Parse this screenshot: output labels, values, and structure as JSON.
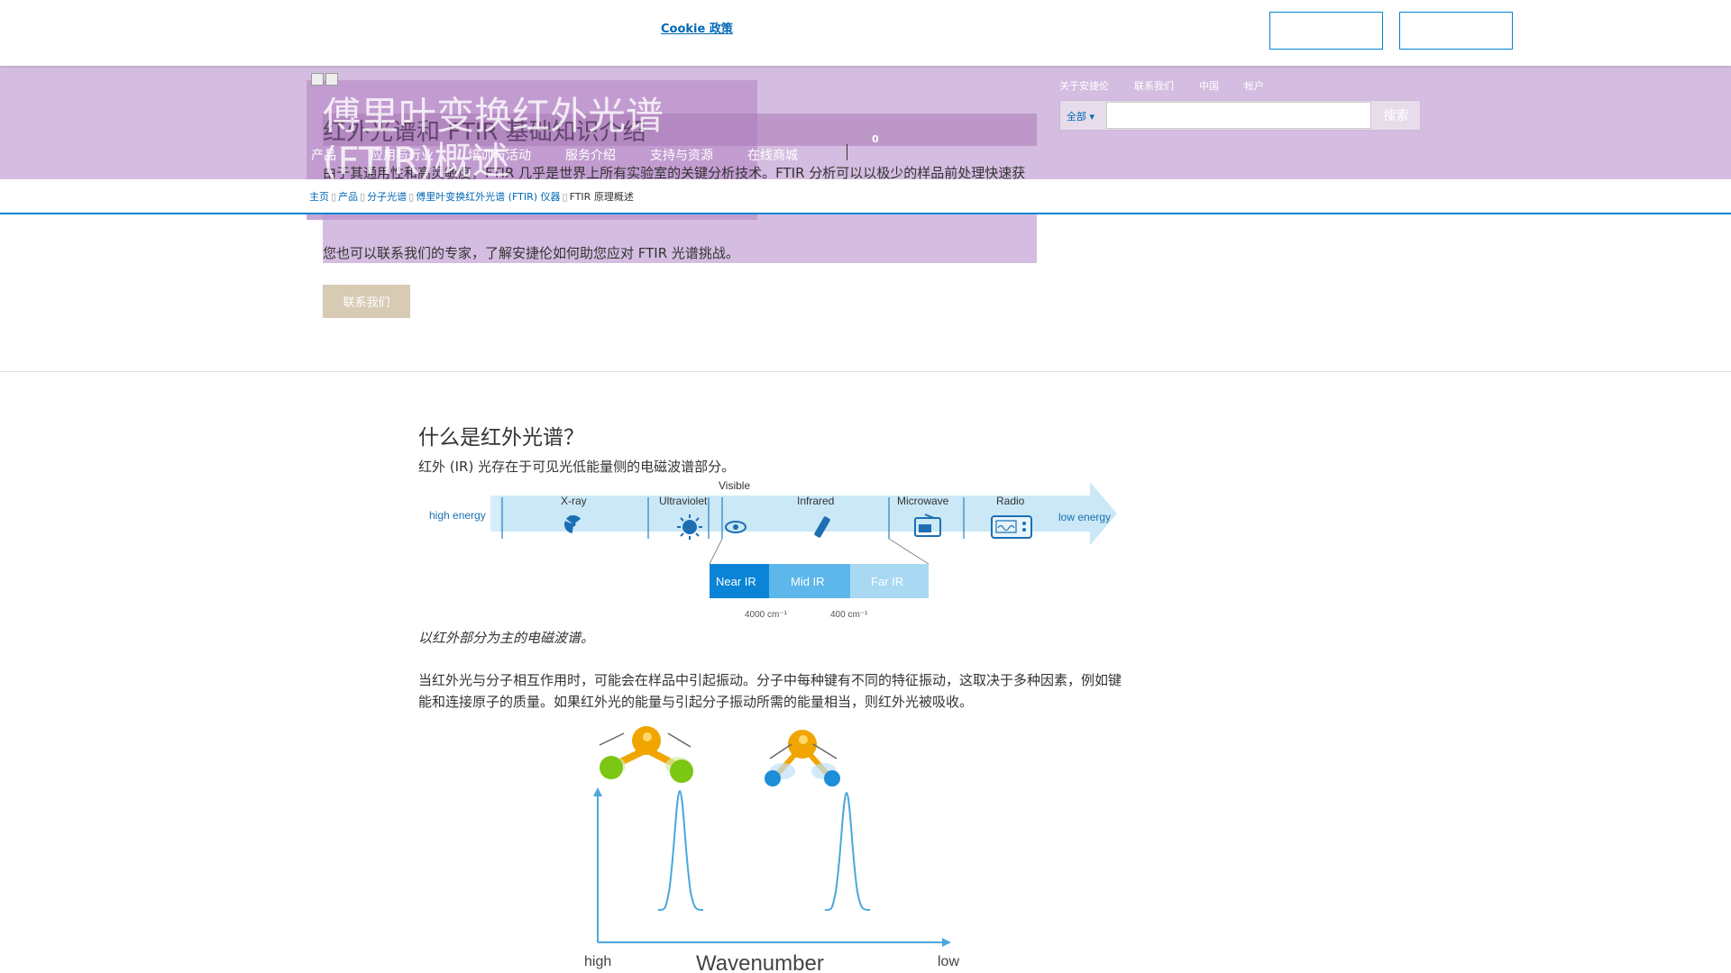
{
  "cookie": {
    "link_text": "Cookie 政策"
  },
  "header": {
    "big_title": "傅里叶变换红外光谱(FTIR)概述",
    "sub_title": "红外光谱和 FTIR 基础知识介绍",
    "nav": [
      "产品",
      "应用与行业",
      "培训与活动",
      "服务介绍",
      "支持与资源",
      "在线商城"
    ],
    "cart_count": "0",
    "util_links": [
      "关于安捷伦",
      "联系我们",
      "中国",
      "帐户"
    ],
    "search": {
      "scope_label": "全部",
      "button_label": "搜索",
      "placeholder": ""
    }
  },
  "breadcrumb": {
    "items": [
      "主页",
      "产品",
      "分子光谱",
      "傅里叶变换红外光谱 (FTIR) 仪器"
    ],
    "current": "FTIR 原理概述"
  },
  "hero": {
    "para1": "由于其通用性和高灵敏度，FTIR 几乎是世界上所有实验室的关键分析技术。FTIR 分析可以以极少的样品前处理快速获得结果。本页将介绍红外光谱基本原理。",
    "para2": "您也可以联系我们的专家，了解安捷伦如何助您应对 FTIR 光谱挑战。",
    "contact_button": "联系我们"
  },
  "article": {
    "heading": "什么是红外光谱？",
    "p1": "红外 (IR) 光存在于可见光低能量侧的电磁波谱部分。",
    "caption": "以红外部分为主的电磁波谱。",
    "p2": "当红外光与分子相互作用时，可能会在样品中引起振动。分子中每种键有不同的特征振动，这取决于多种因素，例如键能和连接原子的质量。如果红外光的能量与引起分子振动所需的能量相当，则红外光被吸收。"
  },
  "spectrum_figure": {
    "left_label": "high energy",
    "right_label": "low energy",
    "bands": [
      "X-ray",
      "Ultraviolet",
      "Visible",
      "Infrared",
      "Microwave",
      "Radio"
    ],
    "ir_regions": [
      "Near IR",
      "Mid IR",
      "Far IR"
    ],
    "ir_ticks": [
      "4000 cm⁻¹",
      "400 cm⁻¹"
    ],
    "colors": {
      "arrow": "#a9d8f2",
      "near": "#0a84d6",
      "mid": "#5db7ea",
      "far": "#a9d8f2"
    }
  },
  "molecule_figure": {
    "x_axis_label": "Wavenumber",
    "x_left": "high",
    "x_right": "low",
    "colors": {
      "center_atom": "#f0a500",
      "outer_green": "#7cc614",
      "outer_blue": "#1d8ed9",
      "peak": "#4aa8dc"
    }
  }
}
